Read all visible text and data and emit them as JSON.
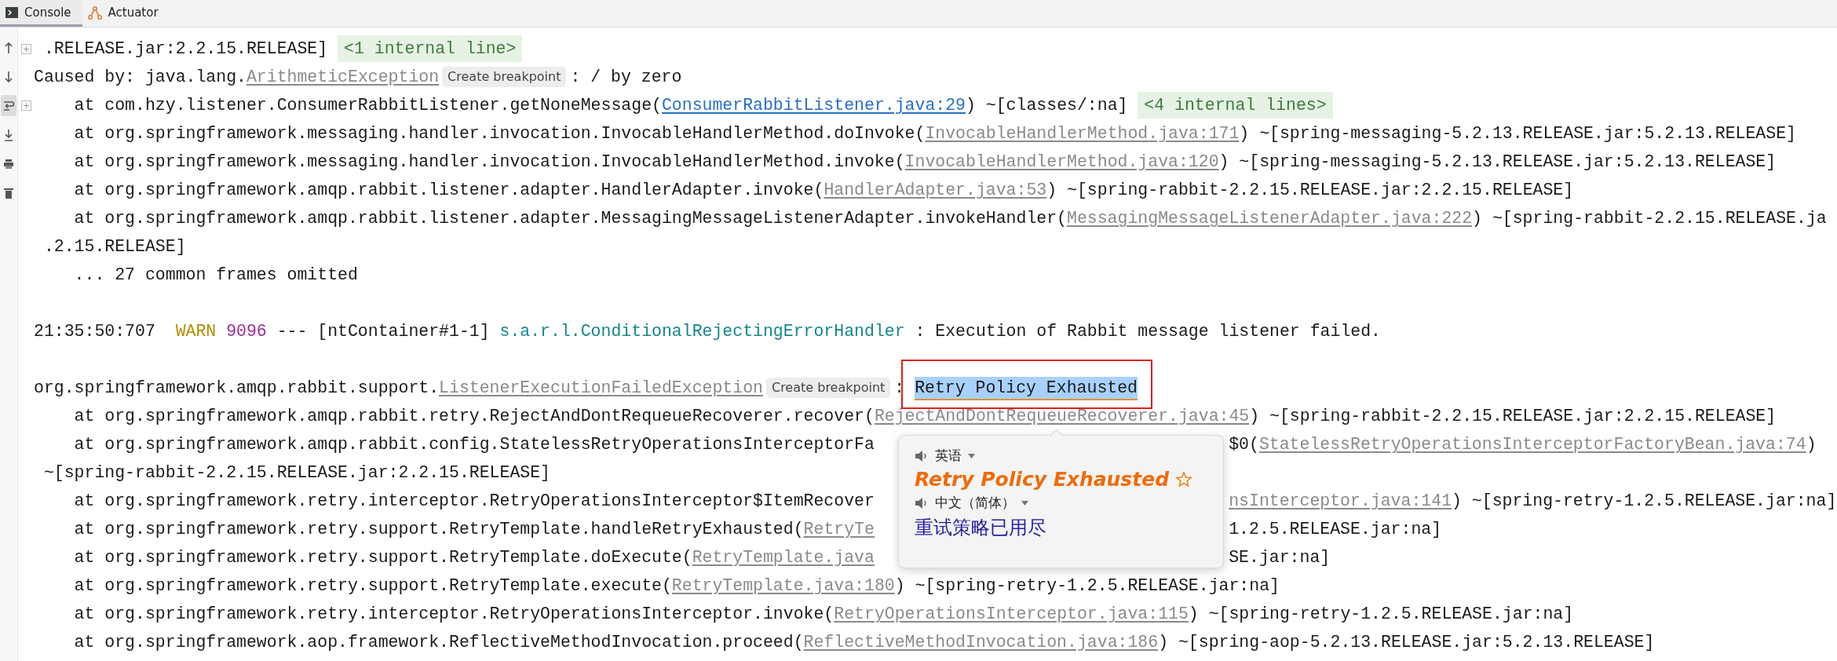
{
  "tabs": [
    {
      "kind": "console",
      "label": "Console",
      "selected": true
    },
    {
      "kind": "actuator",
      "label": "Actuator",
      "selected": false
    }
  ],
  "toolbar": [
    {
      "kind": "up",
      "selected": false
    },
    {
      "kind": "down",
      "selected": false
    },
    {
      "kind": "wrap",
      "selected": true
    },
    {
      "kind": "scroll-end",
      "selected": false
    },
    {
      "kind": "print",
      "selected": false
    },
    {
      "kind": "trash",
      "selected": false
    }
  ],
  "lines": [
    {
      "kind": "line",
      "fold": true,
      "segments": [
        {
          "kind": "text",
          "text": " .RELEASE.jar:2.2.15.RELEASE] "
        },
        {
          "kind": "folded",
          "text": "<1 internal line>"
        }
      ]
    },
    {
      "kind": "line",
      "fold": false,
      "segments": [
        {
          "kind": "text",
          "text": "Caused by: java.lang."
        },
        {
          "kind": "source",
          "text": "ArithmeticException"
        },
        {
          "kind": "hint",
          "text": "Create breakpoint"
        },
        {
          "kind": "text",
          "text": ": / by zero"
        }
      ]
    },
    {
      "kind": "line",
      "fold": true,
      "segments": [
        {
          "kind": "text",
          "text": "    at com.hzy.listener.ConsumerRabbitListener.getNoneMessage("
        },
        {
          "kind": "link",
          "text": "ConsumerRabbitListener.java:29"
        },
        {
          "kind": "text",
          "text": ") ~[classes/:na] "
        },
        {
          "kind": "folded",
          "text": "<4 internal lines>"
        }
      ]
    },
    {
      "kind": "line",
      "fold": false,
      "segments": [
        {
          "kind": "text",
          "text": "    at org.springframework.messaging.handler.invocation.InvocableHandlerMethod.doInvoke("
        },
        {
          "kind": "source",
          "text": "InvocableHandlerMethod.java:171"
        },
        {
          "kind": "text",
          "text": ") ~[spring-messaging-5.2.13.RELEASE.jar:5.2.13.RELEASE]"
        }
      ]
    },
    {
      "kind": "line",
      "fold": false,
      "segments": [
        {
          "kind": "text",
          "text": "    at org.springframework.messaging.handler.invocation.InvocableHandlerMethod.invoke("
        },
        {
          "kind": "source",
          "text": "InvocableHandlerMethod.java:120"
        },
        {
          "kind": "text",
          "text": ") ~[spring-messaging-5.2.13.RELEASE.jar:5.2.13.RELEASE]"
        }
      ]
    },
    {
      "kind": "line",
      "fold": false,
      "segments": [
        {
          "kind": "text",
          "text": "    at org.springframework.amqp.rabbit.listener.adapter.HandlerAdapter.invoke("
        },
        {
          "kind": "source",
          "text": "HandlerAdapter.java:53"
        },
        {
          "kind": "text",
          "text": ") ~[spring-rabbit-2.2.15.RELEASE.jar:2.2.15.RELEASE]"
        }
      ]
    },
    {
      "kind": "line",
      "fold": false,
      "segments": [
        {
          "kind": "text",
          "text": "    at org.springframework.amqp.rabbit.listener.adapter.MessagingMessageListenerAdapter.invokeHandler("
        },
        {
          "kind": "source",
          "text": "MessagingMessageListenerAdapter.java:222"
        },
        {
          "kind": "text",
          "text": ") ~[spring-rabbit-2.2.15.RELEASE.ja"
        }
      ]
    },
    {
      "kind": "line",
      "fold": false,
      "segments": [
        {
          "kind": "text",
          "text": " .2.15.RELEASE]"
        }
      ]
    },
    {
      "kind": "line",
      "fold": false,
      "segments": [
        {
          "kind": "text",
          "text": "    ... 27 common frames omitted"
        }
      ]
    },
    {
      "kind": "blank"
    },
    {
      "kind": "line",
      "fold": false,
      "segments": [
        {
          "kind": "text",
          "text": "21:35:50:707  "
        },
        {
          "kind": "warn",
          "text": "WARN"
        },
        {
          "kind": "pid",
          "text": "9096"
        },
        {
          "kind": "text",
          "text": " --- [ntContainer#1-1] "
        },
        {
          "kind": "logger",
          "text": "s.a.r.l.ConditionalRejectingErrorHandler"
        },
        {
          "kind": "text",
          "text": " : Execution of Rabbit message listener failed."
        }
      ]
    },
    {
      "kind": "blank"
    },
    {
      "kind": "line",
      "fold": false,
      "segments": [
        {
          "kind": "text",
          "text": "org.springframework.amqp.rabbit.support."
        },
        {
          "kind": "source",
          "text": "ListenerExecutionFailedException"
        },
        {
          "kind": "hint",
          "text": "Create breakpoint"
        },
        {
          "kind": "text",
          "text": ": "
        },
        {
          "kind": "selected",
          "text": "Retry Policy Exhausted"
        }
      ]
    },
    {
      "kind": "line",
      "fold": false,
      "segments": [
        {
          "kind": "text",
          "text": "    at org.springframework.amqp.rabbit.retry.RejectAndDontRequeueRecoverer.recover("
        },
        {
          "kind": "source",
          "text": "RejectAndDontRequeueRecoverer.java:45"
        },
        {
          "kind": "text",
          "text": ") ~[spring-rabbit-2.2.15.RELEASE.jar:2.2.15.RELEASE]"
        }
      ]
    },
    {
      "kind": "split",
      "left": [
        {
          "kind": "text",
          "text": "    at org.springframework.amqp.rabbit.config.StatelessRetryOperationsInterceptorFa"
        }
      ],
      "right": [
        {
          "kind": "text",
          "text": "$0("
        },
        {
          "kind": "source",
          "text": "StatelessRetryOperationsInterceptorFactoryBean.java:74"
        },
        {
          "kind": "text",
          "text": ")"
        }
      ]
    },
    {
      "kind": "line",
      "fold": false,
      "segments": [
        {
          "kind": "text",
          "text": " ~[spring-rabbit-2.2.15.RELEASE.jar:2.2.15.RELEASE]"
        }
      ]
    },
    {
      "kind": "split",
      "left": [
        {
          "kind": "text",
          "text": "    at org.springframework.retry.interceptor.RetryOperationsInterceptor$ItemRecover"
        }
      ],
      "right": [
        {
          "kind": "source",
          "text": "nsInterceptor.java:141"
        },
        {
          "kind": "text",
          "text": ") ~[spring-retry-1.2.5.RELEASE.jar:na]"
        }
      ]
    },
    {
      "kind": "split",
      "left": [
        {
          "kind": "text",
          "text": "    at org.springframework.retry.support.RetryTemplate.handleRetryExhausted("
        },
        {
          "kind": "source",
          "text": "RetryTe"
        }
      ],
      "right": [
        {
          "kind": "text",
          "text": "1.2.5.RELEASE.jar:na]"
        }
      ]
    },
    {
      "kind": "split",
      "left": [
        {
          "kind": "text",
          "text": "    at org.springframework.retry.support.RetryTemplate.doExecute("
        },
        {
          "kind": "source",
          "text": "RetryTemplate.java"
        }
      ],
      "right": [
        {
          "kind": "text",
          "text": "SE.jar:na]"
        }
      ]
    },
    {
      "kind": "line",
      "fold": false,
      "segments": [
        {
          "kind": "text",
          "text": "    at org.springframework.retry.support.RetryTemplate.execute("
        },
        {
          "kind": "source",
          "text": "RetryTemplate.java:180"
        },
        {
          "kind": "text",
          "text": ") ~[spring-retry-1.2.5.RELEASE.jar:na]"
        }
      ]
    },
    {
      "kind": "line",
      "fold": false,
      "segments": [
        {
          "kind": "text",
          "text": "    at org.springframework.retry.interceptor.RetryOperationsInterceptor.invoke("
        },
        {
          "kind": "source",
          "text": "RetryOperationsInterceptor.java:115"
        },
        {
          "kind": "text",
          "text": ") ~[spring-retry-1.2.5.RELEASE.jar:na]"
        }
      ]
    },
    {
      "kind": "line",
      "fold": false,
      "segments": [
        {
          "kind": "text",
          "text": "    at org.springframework.aop.framework.ReflectiveMethodInvocation.proceed("
        },
        {
          "kind": "source",
          "text": "ReflectiveMethodInvocation.java:186"
        },
        {
          "kind": "text",
          "text": ") ~[spring-aop-5.2.13.RELEASE.jar:5.2.13.RELEASE]"
        }
      ]
    }
  ],
  "translation_popup": {
    "source_language": "英语",
    "source_text": "Retry Policy Exhausted",
    "target_language": "中文（简体）",
    "target_text": "重试策略已用尽"
  }
}
